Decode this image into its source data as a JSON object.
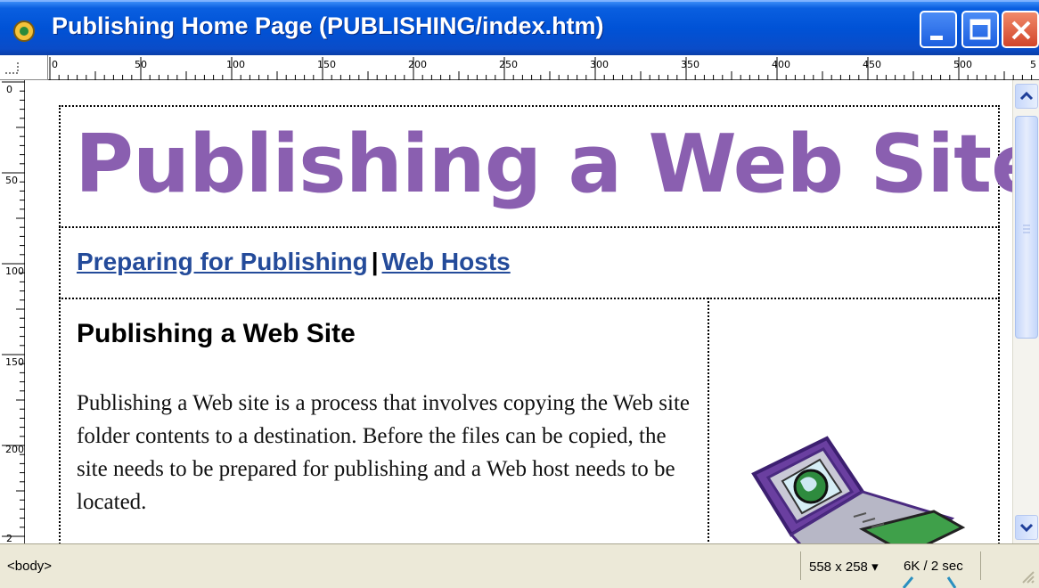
{
  "window": {
    "title": "Publishing Home Page (PUBLISHING/index.htm)",
    "icon": "dreamweaver-document-icon",
    "buttons": [
      "minimize-icon",
      "maximize-icon",
      "close-icon"
    ]
  },
  "rulers": {
    "horizontal": [
      "0",
      "50",
      "100",
      "150",
      "200",
      "250",
      "300",
      "350",
      "400",
      "450",
      "500",
      "5"
    ],
    "vertical": [
      "0",
      "50",
      "100",
      "150",
      "200",
      "2"
    ]
  },
  "document": {
    "banner": "Publishing a Web Site",
    "nav": {
      "link1": "Preparing for Publishing",
      "separator": "|",
      "link2": "Web Hosts"
    },
    "heading": "Publishing a Web Site",
    "paragraph": "Publishing a Web site is a process that involves copying the Web site folder contents to a destination. Before the files can be copied, the site needs to be prepared for publishing and a Web host needs to be located."
  },
  "statusbar": {
    "tag": "<body>",
    "window_size": "558 x 258",
    "download": "6K / 2 sec"
  },
  "colors": {
    "titlebar": "#0052d6",
    "banner": "#8a5fb0",
    "link": "#244b9a",
    "statusbar": "#ece9d8"
  }
}
